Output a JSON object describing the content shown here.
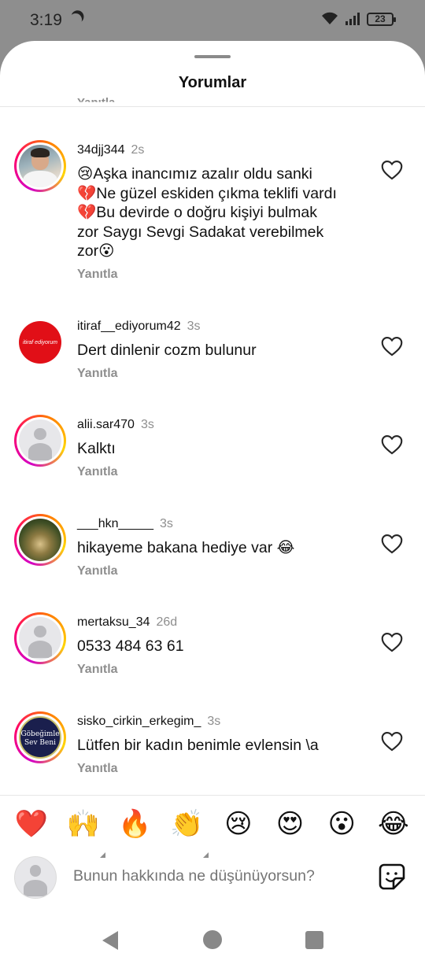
{
  "status": {
    "time": "3:19",
    "battery": "23"
  },
  "sheet": {
    "title": "Yorumlar",
    "cut_reply": "Yanıtla"
  },
  "comments": [
    {
      "username": "34djj344",
      "time": "2s",
      "text": "😢Aşka inancımız azalır oldu sanki\n💔Ne güzel eskiden çıkma teklifi vardı\n💔Bu devirde o doğru kişiyi bulmak\nzor Saygı Sevgi Sadakat verebilmek\nzor😮",
      "reply": "Yanıtla"
    },
    {
      "username": "itiraf__ediyorum42",
      "time": "3s",
      "text": "Dert dinlenir cozm bulunur",
      "reply": "Yanıtla",
      "avatar_text": "itiraf ediyorum"
    },
    {
      "username": "alii.sar470",
      "time": "3s",
      "text": "Kalktı",
      "reply": "Yanıtla"
    },
    {
      "username": "___hkn_____",
      "time": "3s",
      "text": "hikayeme bakana hediye var 😂",
      "reply": "Yanıtla"
    },
    {
      "username": "mertaksu_34",
      "time": "26d",
      "text": "0533 484 63 61",
      "reply": "Yanıtla"
    },
    {
      "username": "sisko_cirkin_erkegim_",
      "time": "3s",
      "text": "Lütfen bir kadın benimle evlensin \\a",
      "reply": "Yanıtla",
      "avatar_text": "Göbeğimle Sev Beni"
    }
  ],
  "reactions": [
    "❤️",
    "🙌",
    "🔥",
    "👏",
    "😢",
    "😍",
    "😮",
    "😂"
  ],
  "input": {
    "placeholder": "Bunun hakkında ne düşünüyorsun?"
  }
}
